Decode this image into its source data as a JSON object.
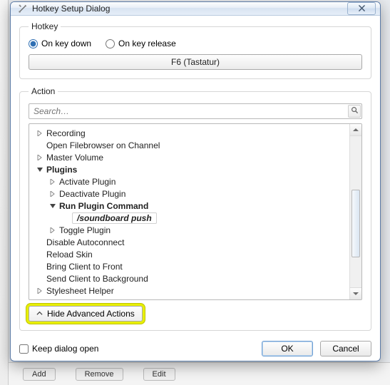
{
  "window": {
    "title": "Hotkey Setup Dialog"
  },
  "hotkey": {
    "legend": "Hotkey",
    "radio_down": "On key down",
    "radio_release": "On key release",
    "selected": "down",
    "button": "F6 (Tastatur)"
  },
  "action": {
    "legend": "Action",
    "search_placeholder": "Search…",
    "advanced_btn": "Hide Advanced Actions",
    "tree": {
      "recording": "Recording",
      "open_filebrowser": "Open Filebrowser on Channel",
      "master_volume": "Master Volume",
      "plugins": "Plugins",
      "activate_plugin": "Activate Plugin",
      "deactivate_plugin": "Deactivate Plugin",
      "run_plugin_command": "Run Plugin Command",
      "selected_command": "/soundboard push",
      "toggle_plugin": "Toggle Plugin",
      "disable_autoconnect": "Disable Autoconnect",
      "reload_skin": "Reload Skin",
      "bring_front": "Bring Client to Front",
      "send_background": "Send Client to Background",
      "stylesheet_helper": "Stylesheet Helper"
    }
  },
  "footer": {
    "keep_open": "Keep dialog open",
    "ok": "OK",
    "cancel": "Cancel"
  },
  "backdrop": {
    "add": "Add",
    "remove": "Remove",
    "edit": "Edit"
  }
}
